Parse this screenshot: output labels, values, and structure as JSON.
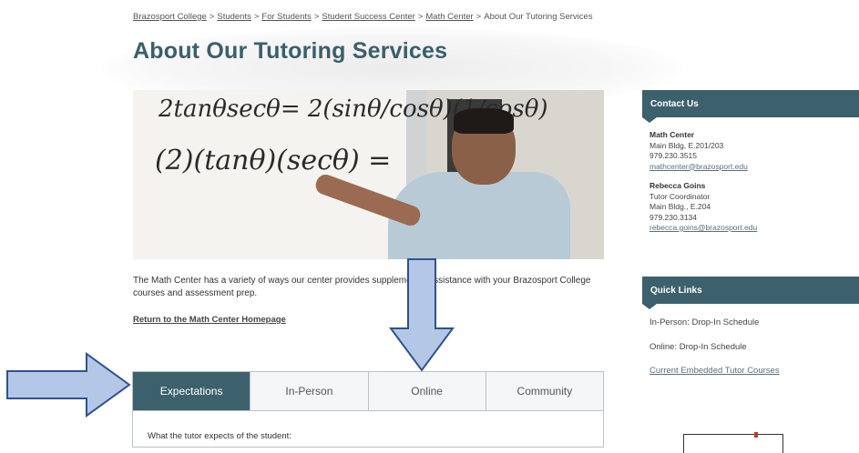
{
  "breadcrumb": [
    {
      "label": "Brazosport College",
      "link": true
    },
    {
      "label": "Students",
      "link": true
    },
    {
      "label": "For Students",
      "link": true
    },
    {
      "label": "Student Success Center",
      "link": true
    },
    {
      "label": "Math Center",
      "link": true
    },
    {
      "label": "About Our Tutoring Services",
      "link": false
    }
  ],
  "breadcrumb_sep": ">",
  "page": {
    "title": "About Our Tutoring Services",
    "intro": "The Math Center has a variety of ways our center provides supplemental assistance with your Brazosport College courses and assessment prep.",
    "home_link": "Return to the Math Center Homepage"
  },
  "tabs": [
    "Expectations",
    "In-Person",
    "Online",
    "Community"
  ],
  "active_tab": "Expectations",
  "tab_panel_text": "What the tutor expects of the student:",
  "sidebar": {
    "contact_title": "Contact Us",
    "contacts": [
      {
        "name": "Math Center",
        "lines": [
          "Main Bldg, E.201/203",
          "979.230.3515"
        ],
        "email": "mathcenter@brazosport.edu"
      },
      {
        "name": "Rebecca Goins",
        "lines": [
          "Tutor Coordinator",
          "Main Bldg., E.204",
          "979.230.3134"
        ],
        "email": "rebecca.goins@brazosport.edu"
      }
    ],
    "quick_links_title": "Quick Links",
    "quick_links": [
      {
        "label": "In-Person:  Drop-In Schedule",
        "link": false
      },
      {
        "label": "Online:  Drop-In Schedule",
        "link": false
      },
      {
        "label": "Current Embedded Tutor Courses",
        "link": true
      }
    ]
  },
  "colors": {
    "accent": "#3c616d",
    "title": "#3b5f6b",
    "arrow_fill": "#b4c7e7",
    "arrow_stroke": "#2f528f"
  },
  "photo_text": [
    "2tanθsecθ= 2(sinθ/cosθ)(1/cosθ)",
    "(2)(tanθ)(secθ) ="
  ]
}
